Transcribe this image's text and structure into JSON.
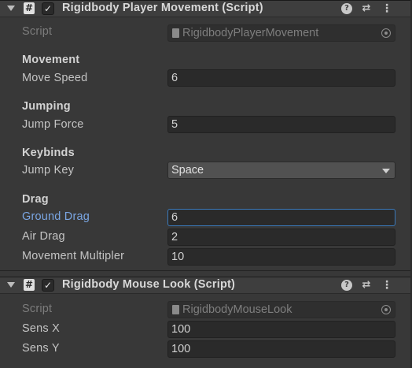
{
  "components": [
    {
      "title": "Rigidbody Player Movement (Script)",
      "script_label": "Script",
      "script_value": "RigidbodyPlayerMovement",
      "icons": {
        "script": "#",
        "enabled": "✓",
        "help": "?",
        "presets": "⇄",
        "menu": "⋮"
      }
    },
    {
      "title": "Rigidbody Mouse Look (Script)",
      "script_label": "Script",
      "script_value": "RigidbodyMouseLook",
      "icons": {
        "script": "#",
        "enabled": "✓",
        "help": "?",
        "presets": "⇄",
        "menu": "⋮"
      }
    }
  ],
  "movement": {
    "header": "Movement",
    "move_speed_label": "Move Speed",
    "move_speed": "6"
  },
  "jumping": {
    "header": "Jumping",
    "jump_force_label": "Jump Force",
    "jump_force": "5"
  },
  "keybinds": {
    "header": "Keybinds",
    "jump_key_label": "Jump Key",
    "jump_key": "Space"
  },
  "drag": {
    "header": "Drag",
    "ground_drag_label": "Ground Drag",
    "ground_drag": "6",
    "air_drag_label": "Air Drag",
    "air_drag": "2",
    "movement_multiplier_label": "Movement Multipler",
    "movement_multiplier": "10"
  },
  "mouse_look": {
    "sens_x_label": "Sens X",
    "sens_x": "100",
    "sens_y_label": "Sens Y",
    "sens_y": "100"
  },
  "colors": {
    "panel_bg": "#383838",
    "header_bg": "#3e3e3e",
    "field_bg": "#2a2a2a",
    "focus_accent": "#3a79bb",
    "focused_label": "#7aa6e3"
  }
}
